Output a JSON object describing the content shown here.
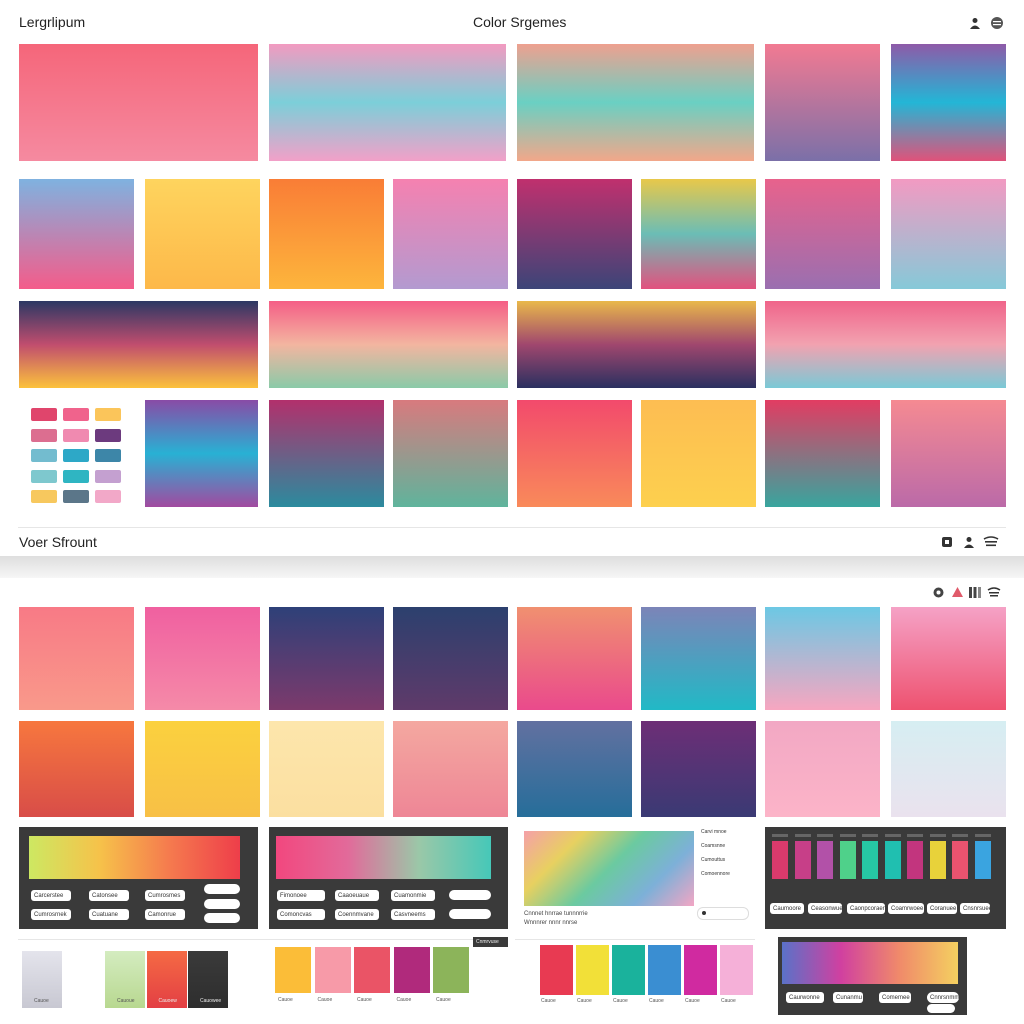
{
  "header": {
    "left_title": "Lergrlipum",
    "center_title": "Color Srgemes"
  },
  "section2": {
    "title": "Voer Sfrount"
  },
  "colors": {
    "panel_dark": "#3a3a3a",
    "divider": "#e6e6e6"
  },
  "top_grid": {
    "row1": [
      {
        "from": "#f5667a",
        "to": "#f58aa0"
      },
      {
        "stops": [
          "#f29ac0",
          "#7ccfd9",
          "#f2a0c8"
        ]
      },
      {
        "stops": [
          "#eea08f",
          "#6ad0c3",
          "#f2a78a"
        ]
      },
      {
        "from": "#f27a92",
        "to": "#7b70a8"
      },
      {
        "stops": [
          "#8e5aa8",
          "#23b6d6",
          "#e0527a"
        ]
      }
    ],
    "row2": [
      {
        "from": "#7fb2e0",
        "to": "#f45c8a"
      },
      {
        "from": "#fed45e",
        "to": "#fdb849"
      },
      {
        "from": "#f97d36",
        "to": "#fdb53c"
      },
      {
        "from": "#f581b0",
        "to": "#b39ad0"
      },
      {
        "from": "#c0306e",
        "to": "#3c4578"
      },
      {
        "stops": [
          "#e8c84a",
          "#6bbdb6",
          "#e2517e"
        ]
      },
      {
        "from": "#e8628c",
        "to": "#9a6fb0"
      },
      {
        "from": "#f29ac2",
        "to": "#86c9d8"
      }
    ],
    "row3": [
      {
        "stops": [
          "#2c3864",
          "#c04d6e",
          "#fcc23c"
        ]
      },
      {
        "stops": [
          "#f55e86",
          "#f3b5a0",
          "#8acaa8"
        ]
      },
      {
        "stops": [
          "#e9b84a",
          "#a0476e",
          "#2a3060"
        ]
      },
      {
        "stops": [
          "#f0648a",
          "#f2a2b0",
          "#7ac9d6"
        ]
      }
    ],
    "row4": [
      {
        "stops": [
          "#894ba6",
          "#28b1d4",
          "#a24aa0"
        ]
      },
      {
        "from": "#b2306c",
        "to": "#2b8b9e"
      },
      {
        "from": "#d87a7e",
        "to": "#5fb49c"
      },
      {
        "from": "#f24a6c",
        "to": "#f98a5a"
      },
      {
        "from": "#fdbd52",
        "to": "#fdd04e"
      },
      {
        "from": "#e23c62",
        "to": "#38a59e"
      },
      {
        "from": "#f58a92",
        "to": "#bb6aa8"
      }
    ]
  },
  "mini_palette": [
    [
      "#e0456c",
      "#f0638c",
      "#fbc55a"
    ],
    [
      "#dc6e90",
      "#f08ab0",
      "#6c3a7e"
    ],
    [
      "#73bccf",
      "#2da8c7",
      "#3d86a8"
    ],
    [
      "#7ec8ce",
      "#2fb5c2",
      "#c4a0d0"
    ],
    [
      "#f7c85e",
      "#5b7689",
      "#f2a8c8"
    ]
  ],
  "bottom_grid": {
    "row1": [
      {
        "from": "#f87a86",
        "to": "#f9998a"
      },
      {
        "from": "#f060a0",
        "to": "#f58aa8"
      },
      {
        "from": "#2e4078",
        "to": "#7c3a6c"
      },
      {
        "from": "#2c406e",
        "to": "#5f3a6a"
      },
      {
        "from": "#f09070",
        "to": "#ea4a8c"
      },
      {
        "from": "#7c84b8",
        "to": "#21b9c6"
      },
      {
        "from": "#6cc8e4",
        "to": "#f7a6c0"
      },
      {
        "from": "#f5a2c6",
        "to": "#ee5270"
      }
    ],
    "row2": [
      {
        "from": "#f7773e",
        "to": "#d84d48"
      },
      {
        "from": "#fbd13e",
        "to": "#f8c046"
      },
      {
        "from": "#fde6ac",
        "to": "#fbdfa0"
      },
      {
        "from": "#f4a8a0",
        "to": "#ee8696"
      },
      {
        "from": "#6270a0",
        "to": "#266e9a"
      },
      {
        "from": "#6d2e76",
        "to": "#3a3a74"
      },
      {
        "from": "#f2a8c4",
        "to": "#fcb4c8"
      },
      {
        "from": "#d6eef2",
        "to": "#eae2ee"
      }
    ]
  },
  "tool_panels": {
    "p1_pills": [
      "Carcerstee",
      "Catonsee",
      "Cumrosmes",
      "Cumrosrnek",
      "Cuatuane",
      "Camonrue"
    ],
    "p2_pills": [
      "Fimonoee",
      "Caaoeuaue",
      "Cuamonmie",
      "Comoncvas",
      "Coennmvane",
      "Casvneems"
    ],
    "p3_side": [
      "Carvi mnoe",
      "Coamsnne",
      "Cumouttus",
      "Comoennore"
    ],
    "p3_caption": "Cnnnet hnrrae tunnnrrie",
    "p3_caption2": "Wnnnrer  nnnr  nnrse",
    "p4_bars": [
      "#d93a6c",
      "#c73f88",
      "#b251a8",
      "#4fd18a",
      "#26c8a4",
      "#20bfb0",
      "#c2357e",
      "#e8d23a",
      "#e9536f",
      "#3aa4e0"
    ],
    "p4_pills": [
      "Caumoore",
      "Ceasonwue",
      "Caonpcoraer",
      "Coamrwoee",
      "Coranuee",
      "Cnsnrsuee",
      "Cumpune"
    ],
    "p8_pills": [
      "Caurwonne",
      "Cunanmu",
      "Comemee",
      "Cnnrsnmmer"
    ]
  },
  "bottom_strips": {
    "strip1": [
      {
        "from": "#e4e4ec",
        "to": "#c8c8d2",
        "label": "Cauoe"
      },
      {
        "from": "#ffffff",
        "to": "#ffffff",
        "label": ""
      },
      {
        "from": "#d4ecc0",
        "to": "#b8d890",
        "label": "Cauoue"
      },
      {
        "from": "#f56a44",
        "to": "#e33f44",
        "label": "Cauoew"
      },
      {
        "from": "#3a3a3a",
        "to": "#2e2e2e",
        "label": "Cauowee"
      }
    ],
    "strip2_tag": "Cnmrvuse",
    "strip2": [
      {
        "color": "#fbbd38",
        "label": "Cauoe"
      },
      {
        "color": "#f79aa8",
        "label": "Cauoe"
      },
      {
        "color": "#ea5466",
        "label": "Cauoe"
      },
      {
        "color": "#b02a7c",
        "label": "Cauoe"
      },
      {
        "color": "#8cb45a",
        "label": "Cauoe"
      }
    ],
    "strip3": [
      {
        "color": "#e83a52",
        "label": "Cauoe"
      },
      {
        "color": "#f2e038",
        "label": "Cauoe"
      },
      {
        "color": "#1ab29c",
        "label": "Cauoe"
      },
      {
        "color": "#3a8ed2",
        "label": "Cauoe"
      },
      {
        "color": "#d02aa0",
        "label": "Cauoe"
      },
      {
        "color": "#f5b0d8",
        "label": "Cauoe"
      }
    ]
  },
  "icons": {
    "header": [
      "user-icon",
      "menu-icon"
    ],
    "section2": [
      "box-icon",
      "user-icon",
      "menu-icon"
    ],
    "toolbar2": [
      "circle-icon",
      "triangle-icon",
      "bars-icon",
      "menu-icon"
    ]
  }
}
